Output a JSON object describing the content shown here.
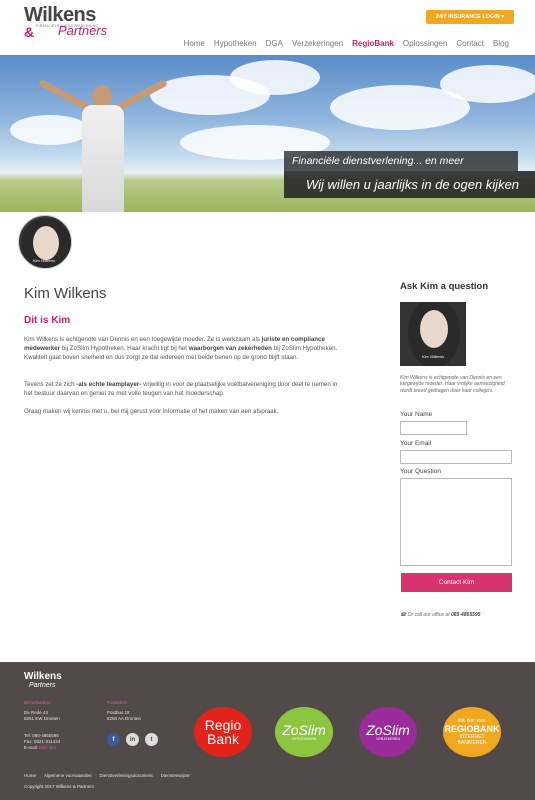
{
  "header": {
    "logo_word": "Wilkens",
    "logo_partners": "Partners",
    "logo_tagline": "FINANCIËLE DIENSTVERLENING",
    "login_button": "24/7 INSURANCE LOGIN ▾",
    "nav": [
      "Home",
      "Hypotheken",
      "DGA",
      "Verzekeringen",
      "RegioBank",
      "Oplossingen",
      "Contact",
      "Blog"
    ],
    "active_nav": "RegioBank"
  },
  "hero": {
    "tagline1": "Financiële dienstverlening... en meer",
    "tagline2": "Wij willen u jaarlijks in de ogen kijken"
  },
  "profile": {
    "signature": "Kim Wilkens",
    "name": "Kim Wilkens",
    "subtitle": "Dit is Kim",
    "para1_a": "Kim Wilkens is echtgenote van Dennis en een toegewijde moeder. Ze is werkzaam als ",
    "para1_b": "juriste en compliance medewerker",
    "para1_c": " bij ZoSlim Hypotheken. Haar kracht ligt bij het ",
    "para1_d": "waarborgen van zekerheden",
    "para1_e": " bij ZoSlim Hypotheken. Kwaliteit gaat boven snelheid en dus zorgt ze dat iedereen met beide benen op de grond blijft staan.",
    "para2_a": "Tevens zet ze zich ",
    "para2_b": "-als echte teamplayer-",
    "para2_c": " vrijwillig in voor de plaatselijke voetbalvereniging door deel te nemen in het bestuur daarvan en geniet ze met volle teugen van het moederschap.",
    "para3": "Graag maken wij kennis met u, bel mij gerust voor informatie of het maken van een afspraak."
  },
  "sidebar": {
    "title": "Ask Kim a question",
    "intro": "Kim Wilkens is echtgenote van Dennis en een toegewijde moeder. Haar vrolijke aanwezigheid wordt breed gedragen door haar collega's.",
    "label_name": "Your Name",
    "label_email": "Your Email",
    "label_question": "Your Question",
    "value_name": "",
    "value_email": "",
    "value_question": "",
    "button": "Contact Kim",
    "call_text": "Or call our office at ",
    "call_phone": "085-4865595"
  },
  "footer": {
    "col1_head": "Bezoekadres",
    "col1_line1": "De Rede 44",
    "col1_line2": "8251 EW Dronten",
    "col1_tel": "Tel: 085-4865595",
    "col1_fax": "Fax: 0321-311424",
    "col1_email_label": "E-mail: ",
    "col1_email": "Mail hier",
    "col2_head": "Postadres",
    "col2_line1": "Postbus 18",
    "col2_line2": "8250 AA Dronten",
    "regio_line1": "Regio",
    "regio_line2": "Bank",
    "zoslim1_text": "ZoSlim",
    "zoslim1_sub": "HYPOTHEKEN",
    "zoslim2_text": "ZoSlim",
    "zoslim2_sub": "VERZEKEREN",
    "ib_line1": "klik hier voor",
    "ib_line2": "REGIOBANK",
    "ib_line3": "INTERNET",
    "ib_line4": "BANKIEREN",
    "nav": [
      "Home",
      "Algemene voorwaarden",
      "Dienstverleningsdocument",
      "Dienstenwijzer"
    ],
    "copyright": "Copyright 2017 Wilkens & Partners"
  },
  "colors": {
    "brand": "#c41e6e",
    "login": "#f0a820",
    "footer_bg": "#524a48",
    "button": "#d6336f",
    "regio": "#e2231a",
    "zoslim1": "#8cc63f",
    "zoslim2": "#9b2a9b",
    "ib": "#f0a820"
  }
}
